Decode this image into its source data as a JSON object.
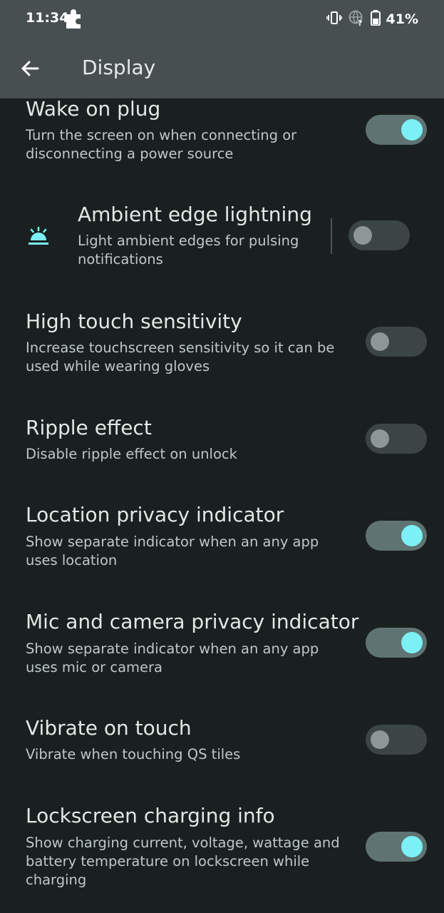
{
  "status_bar": {
    "time": "11:34",
    "battery_percent": "41%",
    "icons": [
      "puzzle-icon",
      "vibrate-icon",
      "globe-question-icon",
      "battery-icon"
    ]
  },
  "app_bar": {
    "title": "Display"
  },
  "colors": {
    "accent": "#7cf0f5",
    "background": "#1a2020",
    "app_bar": "#474f50"
  },
  "settings": [
    {
      "title": "Wake on plug",
      "summary": "Turn the screen on when connecting or disconnecting a power source",
      "enabled": true
    },
    {
      "title": "Ambient edge lightning",
      "summary": "Light ambient edges for pulsing notifications",
      "enabled": false,
      "icon": "sunrise-icon"
    },
    {
      "title": "High touch sensitivity",
      "summary": "Increase touchscreen sensitivity so it can be used while wearing gloves",
      "enabled": false
    },
    {
      "title": "Ripple effect",
      "summary": "Disable ripple effect on unlock",
      "enabled": false
    },
    {
      "title": "Location privacy indicator",
      "summary": "Show separate indicator when an any app uses location",
      "enabled": true
    },
    {
      "title": "Mic and camera privacy indicator",
      "summary": "Show separate indicator when an any app uses mic or camera",
      "enabled": true
    },
    {
      "title": "Vibrate on touch",
      "summary": "Vibrate when touching QS tiles",
      "enabled": false
    },
    {
      "title": "Lockscreen charging info",
      "summary": "Show charging current, voltage, wattage and battery temperature on lockscreen while charging",
      "enabled": true
    }
  ]
}
